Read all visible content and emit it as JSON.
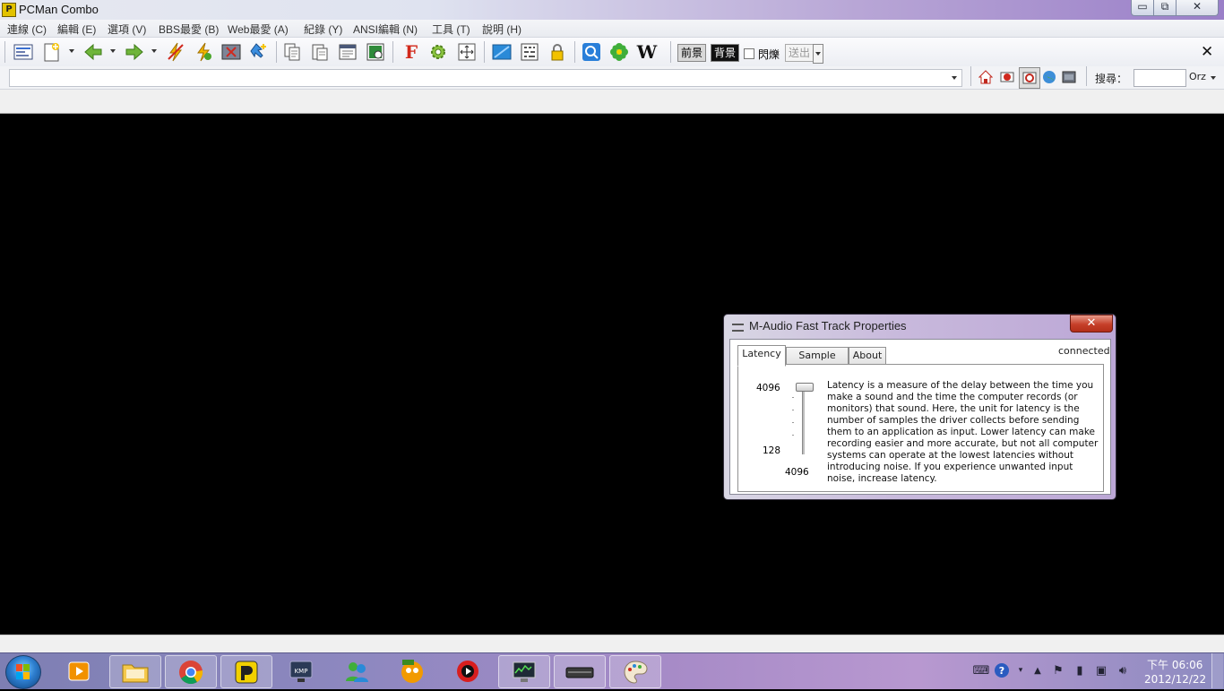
{
  "window": {
    "title": "PCMan Combo",
    "min_glyph": "▭",
    "max_glyph": "⧉",
    "close_glyph": "✕"
  },
  "menu": [
    "連線 (C)",
    "編輯 (E)",
    "選項 (V)",
    "BBS最愛 (B)",
    "Web最愛 (A)",
    "紀錄 (Y)",
    "ANSI編輯 (N)",
    "工具 (T)",
    "說明 (H)"
  ],
  "toolbar": {
    "fg_label": "前景",
    "bg_label": "背景",
    "blink_label": "閃爍",
    "send_label": "送出",
    "close_glyph": "✕",
    "wiki_glyph": "W",
    "f_glyph": "F"
  },
  "address": {
    "search_label": "搜尋：",
    "search_engine": "Orz"
  },
  "dialog": {
    "title": "M-Audio Fast Track Properties",
    "close_glyph": "✕",
    "tabs": [
      "Latency",
      "Sample Rate",
      "About"
    ],
    "active_tab": "Latency",
    "status": "connected",
    "slider_top": "4096",
    "slider_bottom": "128",
    "slider_current": "4096",
    "description": "Latency is a measure of the delay between the time you make a sound and the time the computer records (or monitors) that sound. Here, the unit for latency is the number of samples the driver collects before sending them to an application as input. Lower latency can make recording easier and more accurate, but not all computer systems can operate at the lowest latencies without introducing noise. If you experience unwanted input noise, increase latency."
  },
  "taskbar": {
    "time": "下午 06:06",
    "date": "2012/12/22",
    "apps": [
      "media-player",
      "file-explorer",
      "chrome",
      "pcman",
      "kmplayer",
      "users",
      "pps",
      "qvod",
      "system-monitor",
      "device",
      "paint"
    ]
  },
  "colors": {
    "accent": "#9a7fc8",
    "terminal_bg": "#000000",
    "taskbar": "#8e88c0"
  }
}
